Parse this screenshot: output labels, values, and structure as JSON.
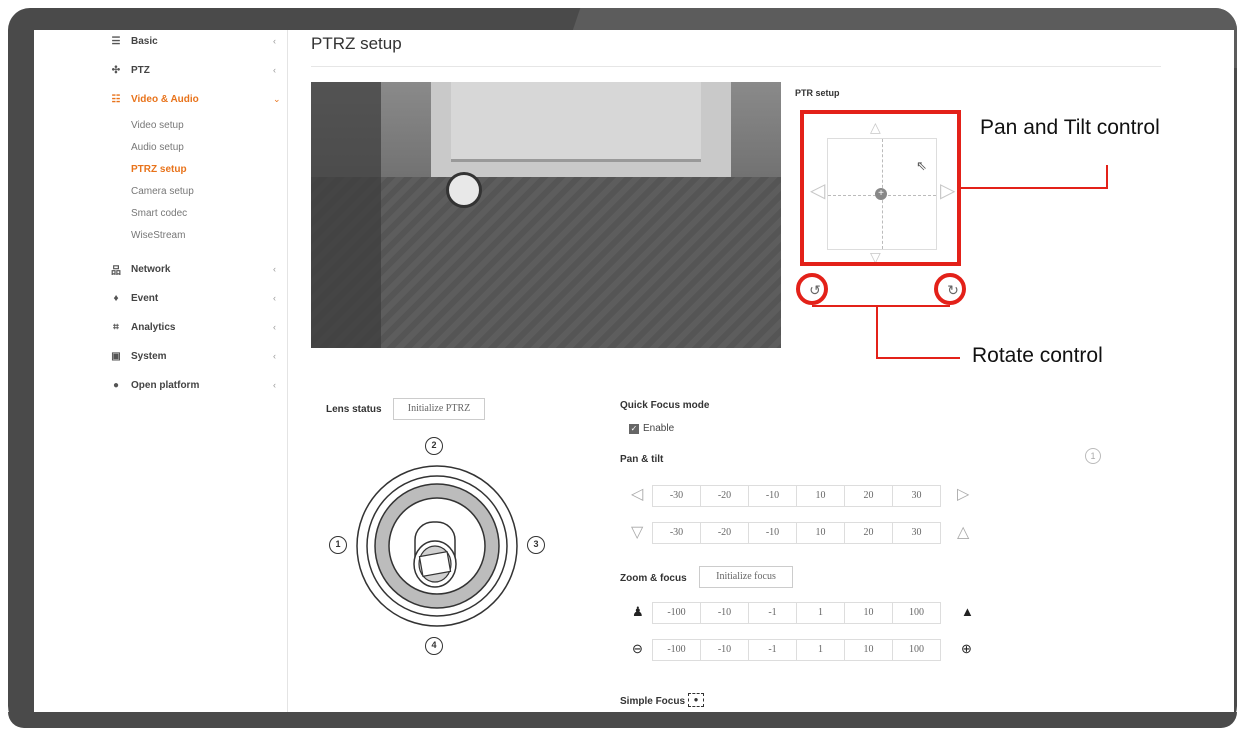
{
  "sidebar": {
    "items": [
      {
        "label": "Basic",
        "icon": "list-icon",
        "glyph": "☰"
      },
      {
        "label": "PTZ",
        "icon": "move-icon",
        "glyph": "✣"
      },
      {
        "label": "Video & Audio",
        "icon": "video-audio-icon",
        "glyph": "☷"
      },
      {
        "label": "Network",
        "icon": "network-icon",
        "glyph": "品"
      },
      {
        "label": "Event",
        "icon": "bell-icon",
        "glyph": "♦"
      },
      {
        "label": "Analytics",
        "icon": "analytics-icon",
        "glyph": "⌗"
      },
      {
        "label": "System",
        "icon": "system-icon",
        "glyph": "▣"
      },
      {
        "label": "Open platform",
        "icon": "open-platform-icon",
        "glyph": "●"
      }
    ],
    "sub_items": [
      "Video setup",
      "Audio setup",
      "PTRZ setup",
      "Camera setup",
      "Smart codec",
      "WiseStream"
    ],
    "accent_color": "#e8731b"
  },
  "page": {
    "title": "PTRZ setup"
  },
  "ptr_setup": {
    "label": "PTR setup"
  },
  "annotations": {
    "pan_tilt": "Pan and Tilt control",
    "rotate": "Rotate control",
    "color": "#e32119"
  },
  "lens": {
    "label": "Lens status",
    "init_button": "Initialize PTRZ",
    "markers": [
      "1",
      "2",
      "3",
      "4"
    ]
  },
  "quick_focus": {
    "label": "Quick Focus mode",
    "checkbox_label": "Enable",
    "checked": true
  },
  "pan_tilt": {
    "label": "Pan & tilt",
    "pan_values": [
      "-30",
      "-20",
      "-10",
      "10",
      "20",
      "30"
    ],
    "tilt_values": [
      "-30",
      "-20",
      "-10",
      "10",
      "20",
      "30"
    ]
  },
  "zoom_focus": {
    "label": "Zoom & focus",
    "init_button": "Initialize focus",
    "zoom_values": [
      "-100",
      "-10",
      "-1",
      "1",
      "10",
      "100"
    ],
    "focus_values": [
      "-100",
      "-10",
      "-1",
      "1",
      "10",
      "100"
    ]
  },
  "simple_focus": {
    "label": "Simple Focus"
  },
  "info_marker": "1"
}
